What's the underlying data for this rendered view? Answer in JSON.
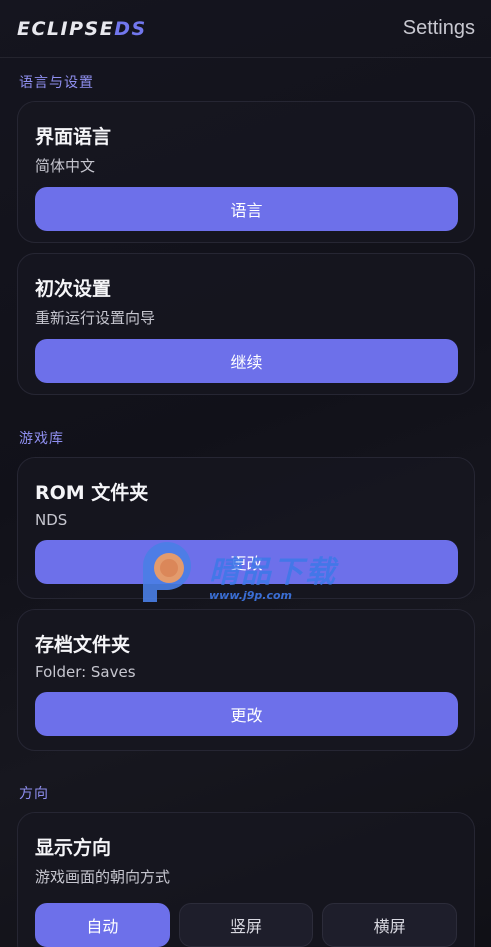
{
  "header": {
    "logo_main": "ECLIPSE",
    "logo_accent": "DS",
    "title": "Settings"
  },
  "sections": {
    "language_setup": "语言与设置",
    "library": "游戏库",
    "orientation": "方向"
  },
  "cards": {
    "language": {
      "title": "界面语言",
      "subtitle": "简体中文",
      "button": "语言"
    },
    "first_setup": {
      "title": "初次设置",
      "subtitle": "重新运行设置向导",
      "button": "继续"
    },
    "rom_folder": {
      "title": "ROM 文件夹",
      "subtitle": "NDS",
      "button": "更改"
    },
    "save_folder": {
      "title": "存档文件夹",
      "subtitle": "Folder: Saves",
      "button": "更改"
    },
    "display_orientation": {
      "title": "显示方向",
      "subtitle": "游戏画面的朝向方式",
      "options": [
        "自动",
        "竖屏",
        "横屏"
      ],
      "selected": "自动"
    }
  },
  "watermark": {
    "text": "晴品下载",
    "url": "www.j9p.com"
  },
  "colors": {
    "accent": "#6d70ea",
    "background": "#13131b",
    "section_label": "#8f8ff0"
  }
}
